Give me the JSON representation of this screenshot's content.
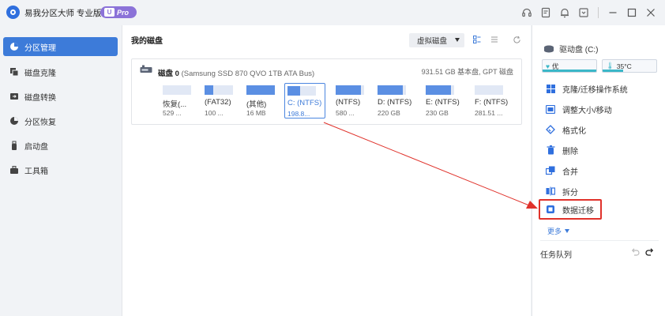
{
  "app": {
    "title": "易我分区大师 专业版",
    "badge_letter": "U",
    "badge": "Pro"
  },
  "titlebar_icons": [
    "headset-icon",
    "feedback-icon",
    "notification-icon",
    "menu-icon",
    "minimize-icon",
    "maximize-icon",
    "close-icon"
  ],
  "sidebar": {
    "items": [
      {
        "label": "分区管理",
        "icon": "pie-chart-icon",
        "active": true
      },
      {
        "label": "磁盘克隆",
        "icon": "disk-clone-icon",
        "active": false
      },
      {
        "label": "磁盘转换",
        "icon": "disk-convert-icon",
        "active": false
      },
      {
        "label": "分区恢复",
        "icon": "partition-recovery-icon",
        "active": false
      },
      {
        "label": "启动盘",
        "icon": "usb-drive-icon",
        "active": false
      },
      {
        "label": "工具箱",
        "icon": "toolbox-icon",
        "active": false
      }
    ]
  },
  "main": {
    "title": "我的磁盘",
    "view_select": "虚拟磁盘",
    "disk": {
      "name": "磁盘 0",
      "model": "(Samsung SSD 870 QVO 1TB ATA Bus)",
      "info": "931.51 GB 基本盘, GPT 磁盘",
      "partitions": [
        {
          "label": "恢复(...",
          "size": "529 ...",
          "fill": 0.0,
          "selected": false
        },
        {
          "label": "(FAT32)",
          "size": "100 ...",
          "fill": 0.3,
          "selected": false
        },
        {
          "label": "(其他)",
          "size": "16 MB",
          "fill": 1.0,
          "selected": false
        },
        {
          "label": "C: (NTFS)",
          "size": "198.8...",
          "fill": 0.45,
          "selected": true
        },
        {
          "label": "(NTFS)",
          "size": "580 ...",
          "fill": 0.9,
          "selected": false
        },
        {
          "label": "D: (NTFS)",
          "size": "220 GB",
          "fill": 0.9,
          "selected": false
        },
        {
          "label": "E: (NTFS)",
          "size": "230 GB",
          "fill": 0.9,
          "selected": false
        },
        {
          "label": "F: (NTFS)",
          "size": "281.51 ...",
          "fill": 0.0,
          "selected": false
        }
      ]
    }
  },
  "right": {
    "drive_title": "驱动盘 (C:)",
    "health_label": "优",
    "temp_label": "35°C",
    "operations": [
      {
        "label": "克隆/迁移操作系统",
        "icon": "windows-icon"
      },
      {
        "label": "调整大小/移动",
        "icon": "resize-icon"
      },
      {
        "label": "格式化",
        "icon": "format-icon"
      },
      {
        "label": "删除",
        "icon": "trash-icon"
      },
      {
        "label": "合并",
        "icon": "merge-icon"
      },
      {
        "label": "拆分",
        "icon": "split-icon"
      },
      {
        "label": "数据迁移",
        "icon": "data-migration-icon",
        "highlighted": true
      }
    ],
    "more_label": "更多",
    "queue_label": "任务队列"
  },
  "colors": {
    "accent": "#3d7bd9",
    "highlight_box": "#e0322b",
    "arrow": "#e0322b"
  }
}
